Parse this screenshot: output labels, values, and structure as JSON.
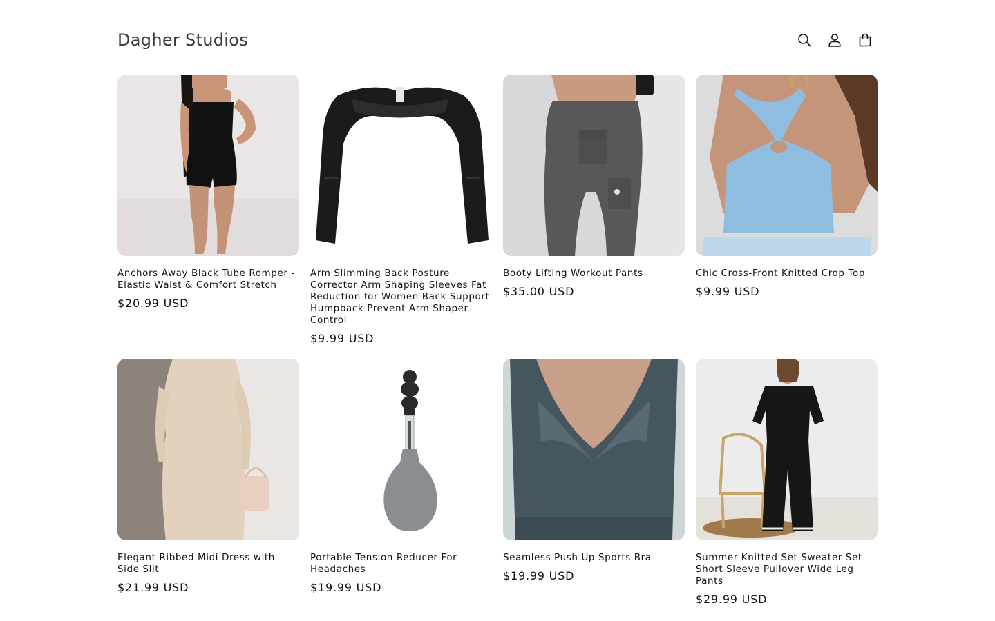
{
  "header": {
    "brand": "Dagher Studios",
    "icons": [
      "search-icon",
      "account-icon",
      "cart-icon"
    ]
  },
  "products": [
    {
      "title": "Anchors Away Black Tube Romper - Elastic Waist & Comfort Stretch",
      "price": "$20.99 USD"
    },
    {
      "title": "Arm Slimming Back Posture Corrector Arm Shaping Sleeves Fat Reduction for Women Back Support Humpback Prevent Arm Shaper Control",
      "price": "$9.99 USD"
    },
    {
      "title": "Booty Lifting Workout Pants",
      "price": "$35.00 USD"
    },
    {
      "title": "Chic Cross-Front Knitted Crop Top",
      "price": "$9.99 USD"
    },
    {
      "title": "Elegant Ribbed Midi Dress with Side Slit",
      "price": "$21.99 USD"
    },
    {
      "title": "Portable Tension Reducer For Headaches",
      "price": "$19.99 USD"
    },
    {
      "title": "Seamless Push Up Sports Bra",
      "price": "$19.99 USD"
    },
    {
      "title": "Summer Knitted Set Sweater Set Short Sleeve Pullover Wide Leg Pants",
      "price": "$29.99 USD"
    }
  ],
  "colors": {
    "text": "#121212",
    "brand_text": "#3a3a3a",
    "background": "#ffffff"
  }
}
